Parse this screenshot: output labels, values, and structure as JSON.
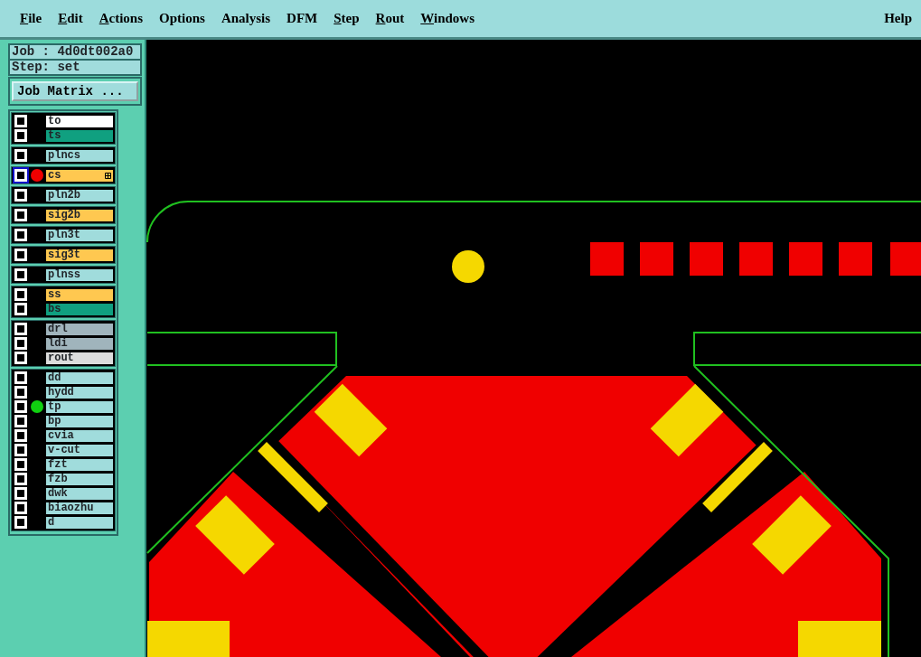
{
  "menu": [
    {
      "label": "File",
      "underline_first": true
    },
    {
      "label": "Edit",
      "underline_first": true
    },
    {
      "label": "Actions",
      "underline_first": true
    },
    {
      "label": "Options",
      "underline_first": false
    },
    {
      "label": "Analysis",
      "underline_first": false
    },
    {
      "label": "DFM",
      "underline_first": false
    },
    {
      "label": "Step",
      "underline_first": true
    },
    {
      "label": "Rout",
      "underline_first": true
    },
    {
      "label": "Windows",
      "underline_first": true
    }
  ],
  "help_menu": {
    "label": "Help",
    "underline_first": false
  },
  "job_label": "Job : 4d0dt002a0",
  "step_label": "Step: set",
  "job_matrix_button": "Job Matrix ...",
  "layer_groups": [
    {
      "layers": [
        {
          "name": "to",
          "color": "#ffffff",
          "selected": false
        },
        {
          "name": "ts",
          "color": "#10a080",
          "selected": false
        }
      ]
    },
    {
      "layers": [
        {
          "name": "plncs",
          "color": "#a0dcdc",
          "selected": false
        }
      ]
    },
    {
      "layers": [
        {
          "name": "cs",
          "color": "#ffc850",
          "selected": true,
          "dot": {
            "color": "#f00000"
          }
        }
      ]
    },
    {
      "layers": [
        {
          "name": "pln2b",
          "color": "#a0dcdc",
          "selected": false
        }
      ]
    },
    {
      "layers": [
        {
          "name": "sig2b",
          "color": "#ffc850",
          "selected": false
        }
      ]
    },
    {
      "layers": [
        {
          "name": "pln3t",
          "color": "#a0dcdc",
          "selected": false
        }
      ]
    },
    {
      "layers": [
        {
          "name": "sig3t",
          "color": "#ffc850",
          "selected": false
        }
      ]
    },
    {
      "layers": [
        {
          "name": "plnss",
          "color": "#a0dcdc",
          "selected": false
        }
      ]
    },
    {
      "layers": [
        {
          "name": "ss",
          "color": "#ffc850",
          "selected": false
        },
        {
          "name": "bs",
          "color": "#10a080",
          "selected": false
        }
      ]
    },
    {
      "layers": [
        {
          "name": "drl",
          "color": "#a0b4bc",
          "selected": false
        },
        {
          "name": "ldi",
          "color": "#a0b4bc",
          "selected": false
        },
        {
          "name": "rout",
          "color": "#dcdcdc",
          "selected": false
        }
      ]
    },
    {
      "layers": [
        {
          "name": "dd",
          "color": "#a0dcdc",
          "selected": false
        },
        {
          "name": "hydd",
          "color": "#a0dcdc",
          "selected": false
        },
        {
          "name": "tp",
          "color": "#a0dcdc",
          "selected": false,
          "dot": {
            "color": "#10d010"
          }
        },
        {
          "name": "bp",
          "color": "#a0dcdc",
          "selected": false
        },
        {
          "name": "cvia",
          "color": "#a0dcdc",
          "selected": false
        },
        {
          "name": "v-cut",
          "color": "#a0dcdc",
          "selected": false
        },
        {
          "name": "fzt",
          "color": "#a0dcdc",
          "selected": false
        },
        {
          "name": "fzb",
          "color": "#a0dcdc",
          "selected": false
        },
        {
          "name": "dwk",
          "color": "#a0dcdc",
          "selected": false
        },
        {
          "name": "biaozhu",
          "color": "#a0dcdc",
          "selected": false
        },
        {
          "name": "d",
          "color": "#a0dcdc",
          "selected": false
        }
      ]
    }
  ]
}
